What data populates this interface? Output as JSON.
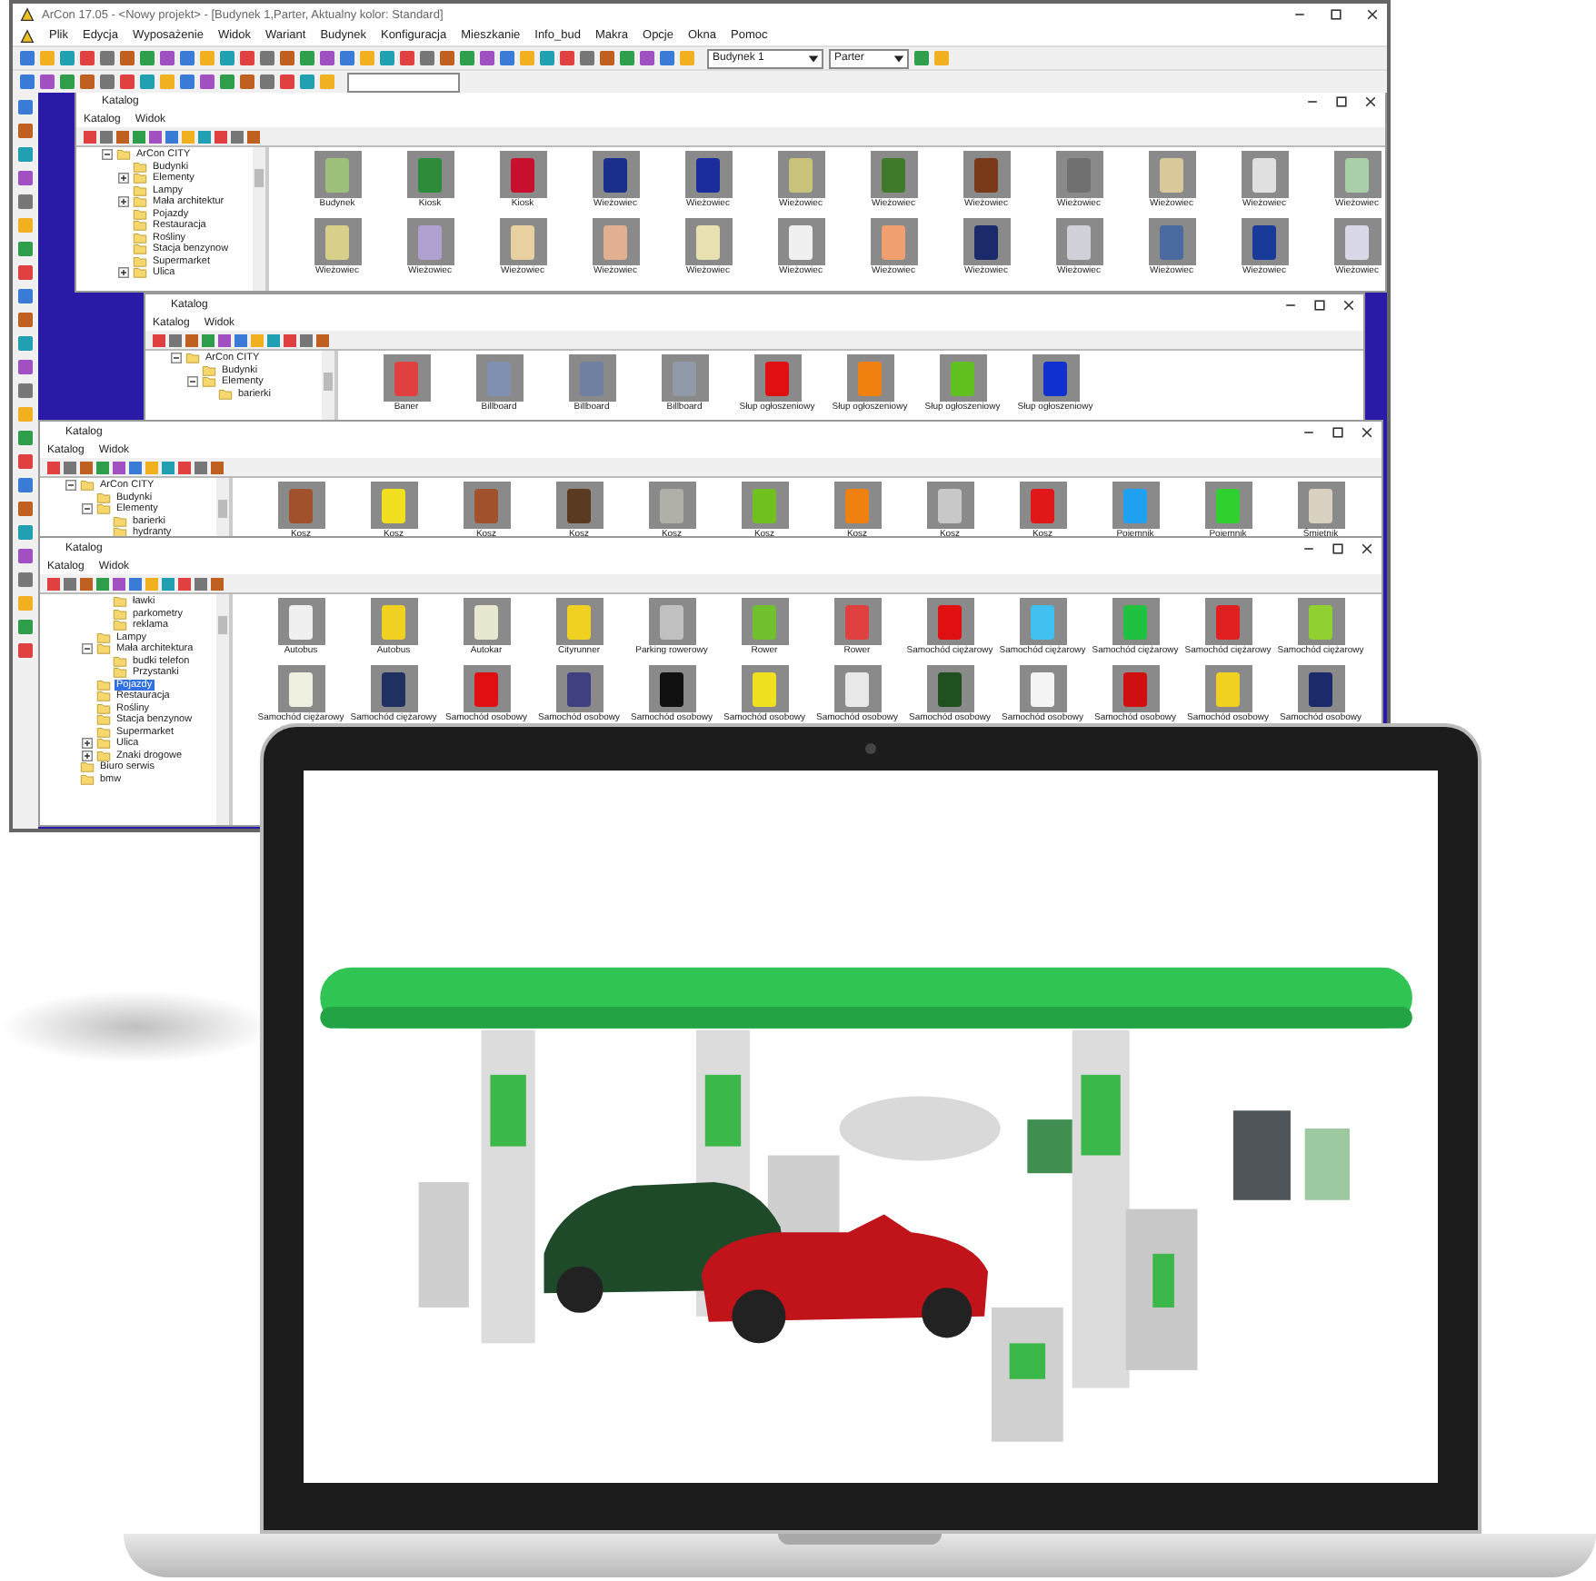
{
  "app": {
    "title": "ArCon 17.05 - <Nowy projekt> - [Budynek 1,Parter, Aktualny kolor: Standard]",
    "menu": [
      "Plik",
      "Edycja",
      "Wyposażenie",
      "Widok",
      "Wariant",
      "Budynek",
      "Konfiguracja",
      "Mieszkanie",
      "Info_bud",
      "Makra",
      "Opcje",
      "Okna",
      "Pomoc"
    ],
    "building_select": {
      "value": "Budynek 1"
    },
    "floor_select": {
      "value": "Parter"
    }
  },
  "catalogs": [
    {
      "title": "Katalog",
      "menu": [
        "Katalog",
        "Widok"
      ],
      "tree": [
        {
          "label": "ArCon CITY",
          "expanded": true,
          "selected": false,
          "children": [
            {
              "label": "Budynki",
              "selected": false
            },
            {
              "label": "Elementy",
              "expanded": false,
              "selected": false
            },
            {
              "label": "Lampy",
              "selected": false
            },
            {
              "label": "Mała architektur",
              "expanded": false,
              "selected": false
            },
            {
              "label": "Pojazdy",
              "selected": false
            },
            {
              "label": "Restauracja",
              "selected": false
            },
            {
              "label": "Rośliny",
              "selected": false
            },
            {
              "label": "Stacja benzynow",
              "selected": false
            },
            {
              "label": "Supermarket",
              "selected": false
            },
            {
              "label": "Ulica",
              "expanded": false,
              "selected": false
            }
          ]
        }
      ],
      "items": [
        {
          "label": "Budynek",
          "color": "#9dc07a"
        },
        {
          "label": "Kiosk",
          "color": "#2e8b3a"
        },
        {
          "label": "Kiosk",
          "color": "#c8102e"
        },
        {
          "label": "Wieżowiec",
          "color": "#1a2f8a"
        },
        {
          "label": "Wieżowiec",
          "color": "#1b2d9c"
        },
        {
          "label": "Wieżowiec",
          "color": "#c9c27a"
        },
        {
          "label": "Wieżowiec",
          "color": "#3f7a2a"
        },
        {
          "label": "Wieżowiec",
          "color": "#7a3a1a"
        },
        {
          "label": "Wieżowiec",
          "color": "#707070"
        },
        {
          "label": "Wieżowiec",
          "color": "#d8c89a"
        },
        {
          "label": "Wieżowiec",
          "color": "#e0e0e0"
        },
        {
          "label": "Wieżowiec",
          "color": "#a8cfa8"
        },
        {
          "label": "Wieżowiec",
          "color": "#d8d08a"
        },
        {
          "label": "Wieżowiec",
          "color": "#b0a0d0"
        },
        {
          "label": "Wieżowiec",
          "color": "#e8d0a0"
        },
        {
          "label": "Wieżowiec",
          "color": "#e0b090"
        },
        {
          "label": "Wieżowiec",
          "color": "#e8e0b0"
        },
        {
          "label": "Wieżowiec",
          "color": "#f0f0f0"
        },
        {
          "label": "Wieżowiec",
          "color": "#f0a070"
        },
        {
          "label": "Wieżowiec",
          "color": "#1a2a6a"
        },
        {
          "label": "Wieżowiec",
          "color": "#d0d0d8"
        },
        {
          "label": "Wieżowiec",
          "color": "#4a6aa0"
        },
        {
          "label": "Wieżowiec",
          "color": "#1a3a9a"
        },
        {
          "label": "Wieżowiec",
          "color": "#d8d8e8"
        }
      ]
    },
    {
      "title": "Katalog",
      "menu": [
        "Katalog",
        "Widok"
      ],
      "tree": [
        {
          "label": "ArCon CITY",
          "expanded": true,
          "selected": false,
          "children": [
            {
              "label": "Budynki",
              "selected": false
            },
            {
              "label": "Elementy",
              "expanded": true,
              "selected": false,
              "children": [
                {
                  "label": "barierki",
                  "selected": false
                }
              ]
            }
          ]
        }
      ],
      "items": [
        {
          "label": "Baner",
          "color": "#e04040"
        },
        {
          "label": "Billboard",
          "color": "#8090b0"
        },
        {
          "label": "Billboard",
          "color": "#7080a0"
        },
        {
          "label": "Billboard",
          "color": "#909aa8"
        },
        {
          "label": "Słup ogłoszeniowy",
          "color": "#e01010"
        },
        {
          "label": "Słup ogłoszeniowy",
          "color": "#f08010"
        },
        {
          "label": "Słup ogłoszeniowy",
          "color": "#60c020"
        },
        {
          "label": "Słup ogłoszeniowy",
          "color": "#1030d0"
        }
      ]
    },
    {
      "title": "Katalog",
      "menu": [
        "Katalog",
        "Widok"
      ],
      "tree": [
        {
          "label": "ArCon CITY",
          "expanded": true,
          "selected": false,
          "children": [
            {
              "label": "Budynki",
              "selected": false
            },
            {
              "label": "Elementy",
              "expanded": true,
              "selected": false,
              "children": [
                {
                  "label": "barierki",
                  "selected": false
                },
                {
                  "label": "hydranty",
                  "selected": false
                }
              ]
            }
          ]
        }
      ],
      "items": [
        {
          "label": "Kosz",
          "color": "#a0522d"
        },
        {
          "label": "Kosz",
          "color": "#f0e020"
        },
        {
          "label": "Kosz",
          "color": "#a0522d"
        },
        {
          "label": "Kosz",
          "color": "#5a3a20"
        },
        {
          "label": "Kosz",
          "color": "#b0b0a8"
        },
        {
          "label": "Kosz",
          "color": "#70c020"
        },
        {
          "label": "Kosz",
          "color": "#f08010"
        },
        {
          "label": "Kosz",
          "color": "#c8c8c8"
        },
        {
          "label": "Kosz",
          "color": "#e01818"
        },
        {
          "label": "Pojemnik",
          "color": "#20a0f0"
        },
        {
          "label": "Pojemnik",
          "color": "#30d030"
        },
        {
          "label": "Śmietnik",
          "color": "#d8d0c0"
        }
      ]
    },
    {
      "title": "Katalog",
      "menu": [
        "Katalog",
        "Widok"
      ],
      "tree": [
        {
          "children": [
            {
              "children": [
                {
                  "label": "ławki",
                  "selected": false
                },
                {
                  "label": "parkometry",
                  "selected": false
                },
                {
                  "label": "reklama",
                  "selected": false
                }
              ]
            },
            {
              "label": "Lampy",
              "selected": false
            },
            {
              "label": "Mała architektura",
              "expanded": true,
              "selected": false,
              "children": [
                {
                  "label": "budki telefon",
                  "selected": false
                },
                {
                  "label": "Przystanki",
                  "selected": false
                }
              ]
            },
            {
              "label": "Pojazdy",
              "selected": true
            },
            {
              "label": "Restauracja",
              "selected": false
            },
            {
              "label": "Rośliny",
              "selected": false
            },
            {
              "label": "Stacja benzynow",
              "selected": false
            },
            {
              "label": "Supermarket",
              "selected": false
            },
            {
              "label": "Ulica",
              "expanded": false,
              "selected": false
            },
            {
              "label": "Znaki drogowe",
              "expanded": false,
              "selected": false
            }
          ]
        },
        {
          "label": "Biuro serwis",
          "selected": false
        },
        {
          "label": "bmw",
          "selected": false
        }
      ],
      "items": [
        {
          "label": "Autobus",
          "color": "#f0f0f0"
        },
        {
          "label": "Autobus",
          "color": "#f0d020"
        },
        {
          "label": "Autokar",
          "color": "#e8e8d0"
        },
        {
          "label": "Cityrunner",
          "color": "#f0d020"
        },
        {
          "label": "Parking rowerowy",
          "color": "#c0c0c0"
        },
        {
          "label": "Rower",
          "color": "#70c030"
        },
        {
          "label": "Rower",
          "color": "#e04040"
        },
        {
          "label": "Samochód ciężarowy",
          "color": "#e01010"
        },
        {
          "label": "Samochód ciężarowy",
          "color": "#40c0f0"
        },
        {
          "label": "Samochód ciężarowy",
          "color": "#20c040"
        },
        {
          "label": "Samochód ciężarowy",
          "color": "#e02020"
        },
        {
          "label": "Samochód ciężarowy",
          "color": "#90d030"
        },
        {
          "label": "Samochód ciężarowy",
          "color": "#f0f0e0"
        },
        {
          "label": "Samochód ciężarowy",
          "color": "#203060"
        },
        {
          "label": "Samochód osobowy",
          "color": "#e01010"
        },
        {
          "label": "Samochód osobowy",
          "color": "#404080"
        },
        {
          "label": "Samochód osobowy",
          "color": "#101010"
        },
        {
          "label": "Samochód osobowy",
          "color": "#f0e020"
        },
        {
          "label": "Samochód osobowy",
          "color": "#e8e8e8"
        },
        {
          "label": "Samochód osobowy",
          "color": "#205020"
        },
        {
          "label": "Samochód osobowy",
          "color": "#f4f4f4"
        },
        {
          "label": "Samochód osobowy",
          "color": "#d01010"
        },
        {
          "label": "Samochód osobowy",
          "color": "#f0d020"
        },
        {
          "label": "Samochód osobowy",
          "color": "#1a2a6a"
        }
      ]
    }
  ]
}
